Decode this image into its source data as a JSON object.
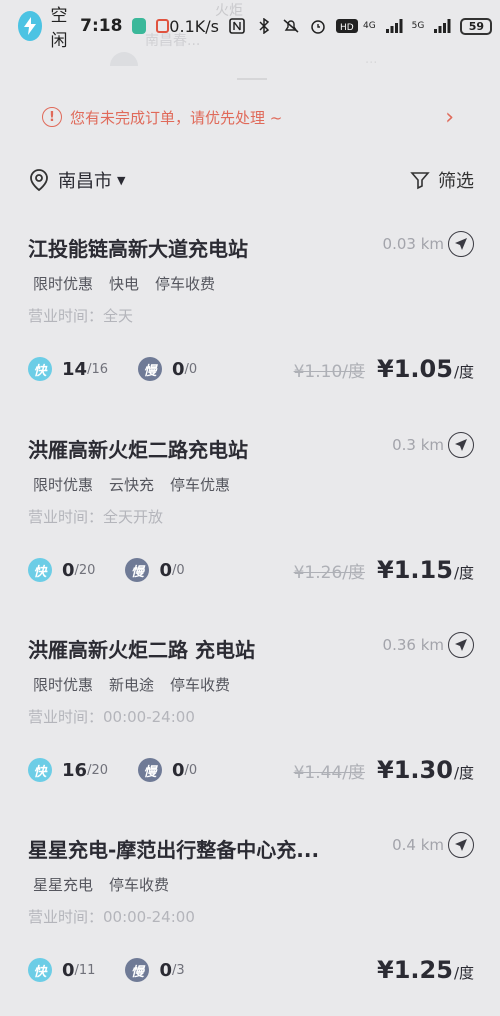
{
  "status_bar": {
    "app_label": "空闲",
    "time": "7:18",
    "speed": "0.1K/s",
    "signal_4g": "4G",
    "signal_5g": "5G",
    "battery": "59"
  },
  "background_ghost": {
    "line1": "火炬",
    "line2": "南昌春...",
    "line3": "..."
  },
  "notice": {
    "text": "您有未完成订单，请优先处理 ~",
    "color": "#e06a5a"
  },
  "location": {
    "city": "南昌市",
    "filter_label": "筛选"
  },
  "stations": [
    {
      "name": "江投能链高新大道充电站",
      "distance": "0.03 km",
      "tags": [
        "限时优惠",
        "快电",
        "停车收费"
      ],
      "hours": "营业时间：全天",
      "fast_label": "快",
      "fast_available": "14",
      "fast_total": "/16",
      "slow_label": "慢",
      "slow_available": "0",
      "slow_total": "/0",
      "old_price": "¥1.10/度",
      "price": "¥1.05",
      "unit": "/度"
    },
    {
      "name": "洪雁高新火炬二路充电站",
      "distance": "0.3 km",
      "tags": [
        "限时优惠",
        "云快充",
        "停车优惠"
      ],
      "hours": "营业时间：全天开放",
      "fast_label": "快",
      "fast_available": "0",
      "fast_total": "/20",
      "slow_label": "慢",
      "slow_available": "0",
      "slow_total": "/0",
      "old_price": "¥1.26/度",
      "price": "¥1.15",
      "unit": "/度"
    },
    {
      "name": "洪雁高新火炬二路 充电站",
      "distance": "0.36 km",
      "tags": [
        "限时优惠",
        "新电途",
        "停车收费"
      ],
      "hours": "营业时间：00:00-24:00",
      "fast_label": "快",
      "fast_available": "16",
      "fast_total": "/20",
      "slow_label": "慢",
      "slow_available": "0",
      "slow_total": "/0",
      "old_price": "¥1.44/度",
      "price": "¥1.30",
      "unit": "/度"
    },
    {
      "name": "星星充电-摩范出行整备中心充...",
      "distance": "0.4 km",
      "tags": [
        "星星充电",
        "停车收费"
      ],
      "hours": "营业时间：00:00-24:00",
      "fast_label": "快",
      "fast_available": "0",
      "fast_total": "/11",
      "slow_label": "慢",
      "slow_available": "0",
      "slow_total": "/3",
      "old_price": "",
      "price": "¥1.25",
      "unit": "/度"
    }
  ],
  "colors": {
    "fast_badge": "#6ccde6",
    "slow_badge": "#6f7a96",
    "background": "#e9e9eb"
  }
}
